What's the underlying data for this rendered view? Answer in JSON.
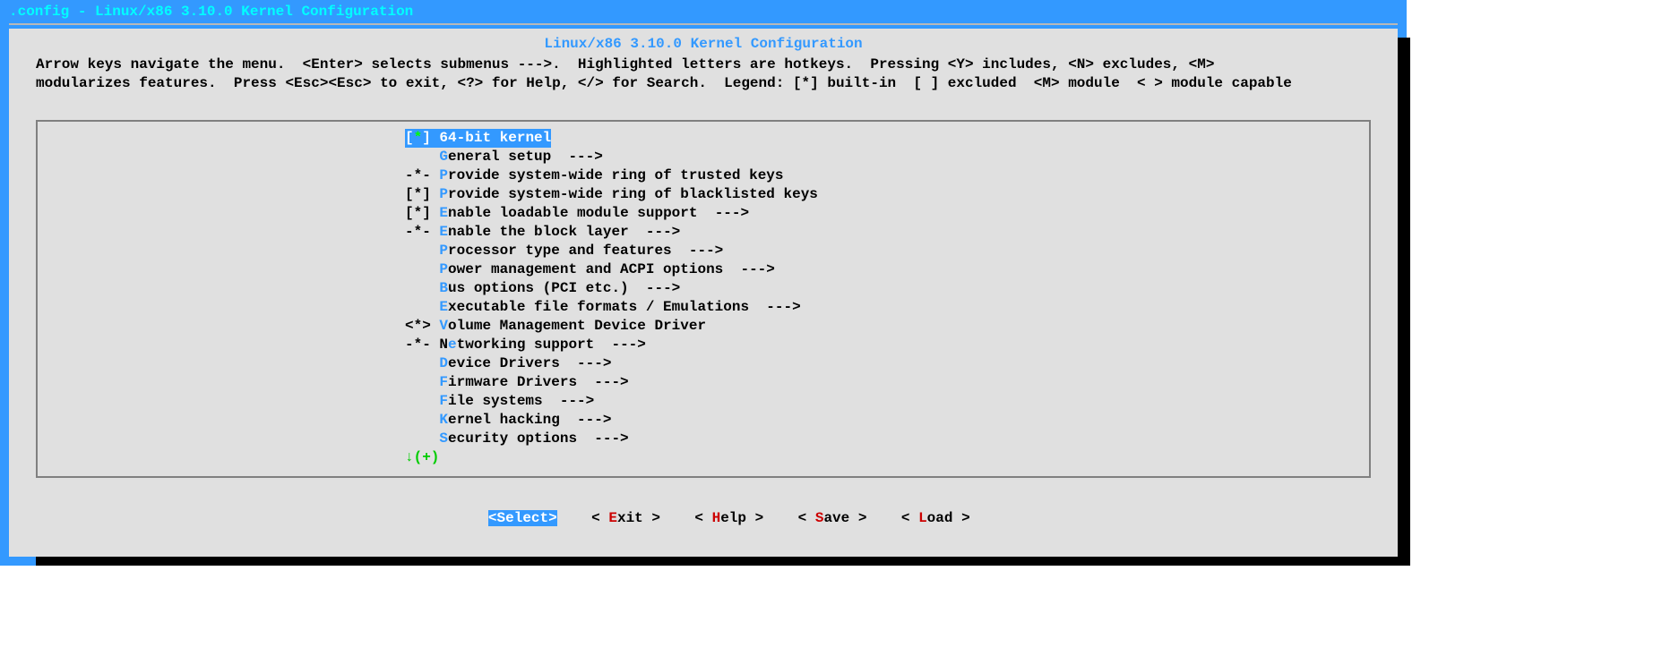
{
  "titlebar": ".config - Linux/x86 3.10.0 Kernel Configuration",
  "panel_title": "Linux/x86 3.10.0 Kernel Configuration",
  "help_line1": "Arrow keys navigate the menu.  <Enter> selects submenus --->.  Highlighted letters are hotkeys.  Pressing <Y> includes, <N> excludes, <M>",
  "help_line2": "modularizes features.  Press <Esc><Esc> to exit, <?> for Help, </> for Search.  Legend: [*] built-in  [ ] excluded  <M> module  < > module capable",
  "menu": [
    {
      "prefix": "[",
      "marker": "*",
      "suffix": "] ",
      "hot": "6",
      "rest": "4-bit kernel",
      "arrow": "",
      "selected": true
    },
    {
      "prefix": "    ",
      "marker": "",
      "suffix": "",
      "hot": "G",
      "rest": "eneral setup  ",
      "arrow": "--->",
      "selected": false
    },
    {
      "prefix": "-",
      "marker": "*",
      "suffix": "- ",
      "hot": "P",
      "rest": "rovide system-wide ring of trusted keys",
      "arrow": "",
      "selected": false
    },
    {
      "prefix": "[",
      "marker": "*",
      "suffix": "] ",
      "hot": "P",
      "rest": "rovide system-wide ring of blacklisted keys",
      "arrow": "",
      "selected": false
    },
    {
      "prefix": "[",
      "marker": "*",
      "suffix": "] ",
      "hot": "E",
      "rest": "nable loadable module support  ",
      "arrow": "--->",
      "selected": false
    },
    {
      "prefix": "-",
      "marker": "*",
      "suffix": "- ",
      "hot": "E",
      "rest": "nable the block layer  ",
      "arrow": "--->",
      "selected": false
    },
    {
      "prefix": "    ",
      "marker": "",
      "suffix": "",
      "hot": "P",
      "rest": "rocessor type and features  ",
      "arrow": "--->",
      "selected": false
    },
    {
      "prefix": "    ",
      "marker": "",
      "suffix": "",
      "hot": "P",
      "rest": "ower management and ACPI options  ",
      "arrow": "--->",
      "selected": false
    },
    {
      "prefix": "    ",
      "marker": "",
      "suffix": "",
      "hot": "B",
      "rest": "us options (PCI etc.)  ",
      "arrow": "--->",
      "selected": false
    },
    {
      "prefix": "    ",
      "marker": "",
      "suffix": "",
      "hot": "E",
      "rest": "xecutable file formats / Emulations  ",
      "arrow": "--->",
      "selected": false
    },
    {
      "prefix": "<",
      "marker": "*",
      "suffix": "> ",
      "hot": "V",
      "rest": "olume Management Device Driver",
      "arrow": "",
      "selected": false
    },
    {
      "prefix": "-",
      "marker": "*",
      "suffix": "- N",
      "hot": "e",
      "rest": "tworking support  ",
      "arrow": "--->",
      "selected": false
    },
    {
      "prefix": "    ",
      "marker": "",
      "suffix": "",
      "hot": "D",
      "rest": "evice Drivers  ",
      "arrow": "--->",
      "selected": false
    },
    {
      "prefix": "    ",
      "marker": "",
      "suffix": "",
      "hot": "F",
      "rest": "irmware Drivers  ",
      "arrow": "--->",
      "selected": false
    },
    {
      "prefix": "    ",
      "marker": "",
      "suffix": "",
      "hot": "F",
      "rest": "ile systems  ",
      "arrow": "--->",
      "selected": false
    },
    {
      "prefix": "    ",
      "marker": "",
      "suffix": "",
      "hot": "K",
      "rest": "ernel hacking  ",
      "arrow": "--->",
      "selected": false
    },
    {
      "prefix": "    ",
      "marker": "",
      "suffix": "",
      "hot": "S",
      "rest": "ecurity options  ",
      "arrow": "--->",
      "selected": false
    }
  ],
  "scroll_indicator": "↓(+)",
  "buttons": {
    "select": {
      "open": "<",
      "hot": "S",
      "rest": "elect",
      "close": ">",
      "active": true
    },
    "exit": {
      "open": "< ",
      "hot": "E",
      "rest": "xit ",
      "close": ">",
      "active": false
    },
    "help": {
      "open": "< ",
      "hot": "H",
      "rest": "elp ",
      "close": ">",
      "active": false
    },
    "save": {
      "open": "< ",
      "hot": "S",
      "rest": "ave ",
      "close": ">",
      "active": false
    },
    "load": {
      "open": "< ",
      "hot": "L",
      "rest": "oad ",
      "close": ">",
      "active": false
    }
  }
}
